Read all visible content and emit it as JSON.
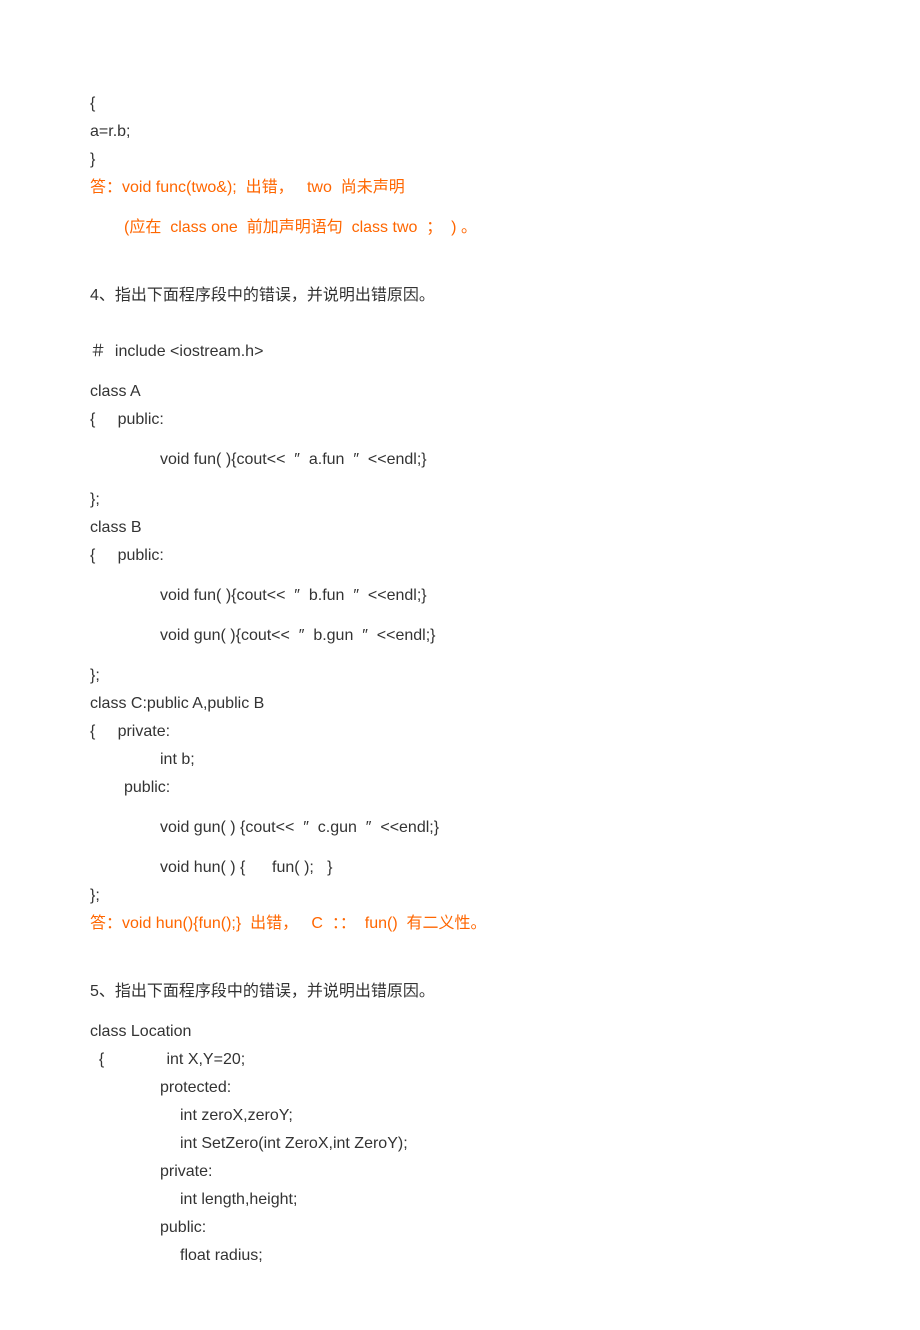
{
  "intro": {
    "l1": "{",
    "l2": "a=r.b;",
    "l3": "}",
    "ans1": "答：void func(two&);  出错，   two  尚未声明",
    "ans2": "(应在  class one  前加声明语句  class two  ；  ) 。"
  },
  "q4": {
    "title": "4、指出下面程序段中的错误，并说明出错原因。",
    "inc": "＃  include <iostream.h>",
    "c1": "class A",
    "c2": "{     public:",
    "c3": "void fun( ){cout<<  ″  a.fun  ″  <<endl;}",
    "c4": "};",
    "c5": "class B",
    "c6": "{     public:",
    "c7": "void fun( ){cout<<  ″  b.fun  ″  <<endl;}",
    "c8": "void gun( ){cout<<  ″  b.gun  ″  <<endl;}",
    "c9": "};",
    "c10": "class C:public A,public B",
    "c11": "{     private:",
    "c12": "int b;",
    "c13": "public:",
    "c14": "void gun( ) {cout<<  ″  c.gun  ″  <<endl;}",
    "c15": "void hun( ) {      fun( );   }",
    "c16": "};",
    "ans": "答：void hun(){fun();}  出错，   C  ：：  fun()  有二义性。"
  },
  "q5": {
    "title": "5、指出下面程序段中的错误，并说明出错原因。",
    "c1": "class Location",
    "c2": "  {              int X,Y=20;",
    "c3": "protected:",
    "c4": "int zeroX,zeroY;",
    "c5": "int SetZero(int ZeroX,int ZeroY);",
    "c6": "private:",
    "c7": "int length,height;",
    "c8": "public:",
    "c9": "float radius;"
  }
}
